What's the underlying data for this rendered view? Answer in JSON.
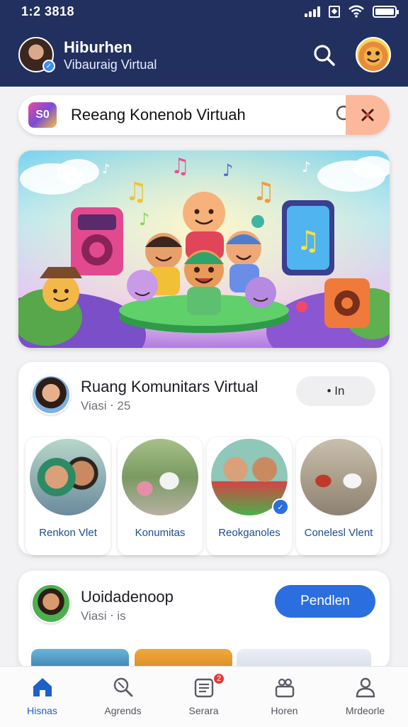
{
  "status_bar": {
    "time": "1:2 3818",
    "battery_level": 1.0
  },
  "header": {
    "title": "Hiburhen",
    "subtitle": "Vibauraig Virtual",
    "avatar_icon": "user-avatar",
    "search_icon": "search-icon"
  },
  "search_bar": {
    "logo_text": "S0",
    "text": "Reeang Konenob Virtuah",
    "search_icon": "search-icon",
    "action_icon": "sparkle-icon"
  },
  "hero": {
    "illustration": "cartoon-kids-music-banner"
  },
  "community_card": {
    "title": "Ruang Komunitars Virtual",
    "subtitle": "Viasi ⋅ 25",
    "pill_label": "• In",
    "tiles": [
      {
        "label": "Renkon Vlet",
        "photo_colors": [
          "#b7d7c9",
          "#6b4a35"
        ]
      },
      {
        "label": "Konumitas",
        "photo_colors": [
          "#a7c08a",
          "#d7d1c6"
        ]
      },
      {
        "label": "Reokganoles",
        "photo_colors": [
          "#8fc7b8",
          "#c84b4b"
        ],
        "badge": "✓"
      },
      {
        "label": "Conelesl Vlent",
        "photo_colors": [
          "#c9bfae",
          "#3b3f6b"
        ]
      }
    ]
  },
  "second_card": {
    "title": "Uoidadenoop",
    "subtitle": "Viasi ⋅ is",
    "button_label": "Pendlen"
  },
  "bottom_nav": {
    "items": [
      {
        "label": "Hisnas",
        "icon": "home-icon",
        "active": true
      },
      {
        "label": "Agrends",
        "icon": "explore-icon",
        "active": false
      },
      {
        "label": "Serara",
        "icon": "list-icon",
        "active": false,
        "badge": "2"
      },
      {
        "label": "Horen",
        "icon": "group-icon",
        "active": false
      },
      {
        "label": "Mrdeorle",
        "icon": "profile-icon",
        "active": false
      }
    ]
  },
  "colors": {
    "header_bg": "#22305f",
    "accent_blue": "#2b6ee0",
    "accent_peach": "#fbb89a",
    "badge_red": "#e53935"
  }
}
